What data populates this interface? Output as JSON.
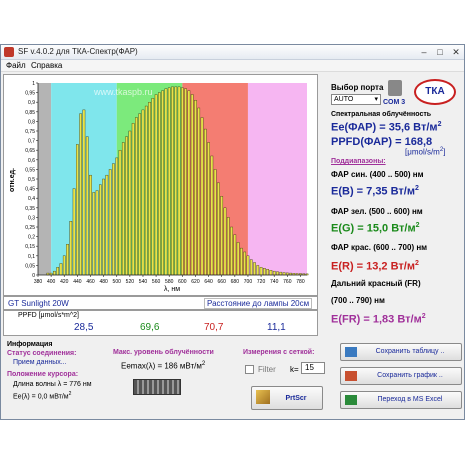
{
  "window": {
    "title": "SF v.4.0.2 для ТКА-Спектр(ФАР)",
    "menu": [
      "Файл",
      "Справка"
    ]
  },
  "plot": {
    "ylabel": "отн.ед.",
    "xlabel": "λ, нм",
    "watermark": "www.tkaspb.ru",
    "y_ticks": [
      "1",
      "0,95",
      "0,9",
      "0,85",
      "0,8",
      "0,75",
      "0,7",
      "0,65",
      "0,6",
      "0,55",
      "0,5",
      "0,45",
      "0,4",
      "0,35",
      "0,3",
      "0,25",
      "0,2",
      "0,15",
      "0,1",
      "0,05",
      "0"
    ],
    "x_ticks": [
      "380",
      "400",
      "420",
      "440",
      "460",
      "480",
      "500",
      "520",
      "540",
      "560",
      "580",
      "600",
      "620",
      "640",
      "660",
      "680",
      "700",
      "720",
      "740",
      "760",
      "780"
    ],
    "bands": [
      {
        "from": 380,
        "to": 400,
        "color": "#b4b4b4"
      },
      {
        "from": 400,
        "to": 500,
        "color": "#7fe6ec"
      },
      {
        "from": 500,
        "to": 600,
        "color": "#7cea7c"
      },
      {
        "from": 600,
        "to": 700,
        "color": "#f47d72"
      },
      {
        "from": 700,
        "to": 790,
        "color": "#f6b6f2"
      }
    ],
    "bar_color": "#e8e44a"
  },
  "chart_data": {
    "type": "bar",
    "x": [
      380,
      385,
      390,
      395,
      400,
      405,
      410,
      415,
      420,
      425,
      430,
      435,
      440,
      445,
      450,
      455,
      460,
      465,
      470,
      475,
      480,
      485,
      490,
      495,
      500,
      505,
      510,
      515,
      520,
      525,
      530,
      535,
      540,
      545,
      550,
      555,
      560,
      565,
      570,
      575,
      580,
      585,
      590,
      595,
      600,
      605,
      610,
      615,
      620,
      625,
      630,
      635,
      640,
      645,
      650,
      655,
      660,
      665,
      670,
      675,
      680,
      685,
      690,
      695,
      700,
      705,
      710,
      715,
      720,
      725,
      730,
      735,
      740,
      745,
      750,
      755,
      760,
      765,
      770,
      775,
      780,
      785,
      790
    ],
    "values": [
      0,
      0,
      0,
      0.01,
      0.01,
      0.02,
      0.04,
      0.06,
      0.1,
      0.16,
      0.28,
      0.45,
      0.68,
      0.84,
      0.86,
      0.72,
      0.52,
      0.43,
      0.44,
      0.47,
      0.5,
      0.52,
      0.55,
      0.58,
      0.61,
      0.65,
      0.69,
      0.72,
      0.75,
      0.79,
      0.82,
      0.84,
      0.86,
      0.88,
      0.9,
      0.92,
      0.94,
      0.95,
      0.96,
      0.97,
      0.975,
      0.98,
      0.98,
      0.98,
      0.975,
      0.97,
      0.96,
      0.94,
      0.91,
      0.87,
      0.82,
      0.76,
      0.69,
      0.62,
      0.55,
      0.48,
      0.41,
      0.35,
      0.3,
      0.25,
      0.21,
      0.17,
      0.14,
      0.12,
      0.1,
      0.08,
      0.065,
      0.05,
      0.04,
      0.035,
      0.03,
      0.025,
      0.02,
      0.017,
      0.015,
      0.013,
      0.011,
      0.01,
      0.009,
      0.008,
      0.008,
      0.007,
      0.006
    ],
    "xlabel": "λ, нм",
    "ylabel": "отн.ед.",
    "xlim": [
      380,
      790
    ],
    "ylim": [
      0,
      1
    ],
    "grid": false
  },
  "info": {
    "lamp": "GT Sunlight 20W",
    "distance": "Расстояние до лампы 20см"
  },
  "ppfd": {
    "label": "PPFD [μmol/s*m^2]",
    "values": [
      {
        "value": "28,5",
        "color": "#1a2a9a"
      },
      {
        "value": "69,6",
        "color": "#1a8a1a"
      },
      {
        "value": "70,7",
        "color": "#c82020"
      },
      {
        "value": "11,1",
        "color": "#1a2a9a"
      }
    ]
  },
  "port": {
    "label": "Выбор порта",
    "value": "AUTO",
    "com": "COM 3",
    "logo": "ТКА"
  },
  "results": {
    "section_title": "Спектральная облучённость",
    "ee_far": "Ee(ФАР) = 35,6 Вт/м",
    "ee_far_sup": "2",
    "ppfd_far": "PPFD(ФАР) = 168,8",
    "ppfd_unit": "[μmol/s/m",
    "ppfd_unit_sup": "2",
    "ppfd_unit_end": "]",
    "subranges_title": "Поддиапазоны:",
    "blue_label": "ФАР син. (400 .. 500) нм",
    "blue_value": "E(B) = 7,35 Вт/м",
    "green_label": "ФАР зел. (500 .. 600) нм",
    "green_value": "E(G) = 15,0 Вт/м",
    "red_label": "ФАР крас. (600 .. 700) нм",
    "red_value": "E(R) = 13,2 Вт/м",
    "fr_label": "Дальний красный (FR)",
    "fr_range": "(700 .. 790) нм",
    "fr_value": "E(FR) = 1,83 Вт/м",
    "sup2": "2"
  },
  "bottom": {
    "info_title": "Информация",
    "conn_label": "Статус соединения:",
    "conn_value": "Прием данных...",
    "cursor_label": "Положение курсора:",
    "wl_text": "Длина волны λ = 776 нм",
    "ee_text": "Ee(λ) = 0,0 мВт/м",
    "ee_sup": "2",
    "max_label": "Макс. уровень облучённости",
    "emax": "Eemax(λ) = 186 мВт/м",
    "emax_sup": "2",
    "series_label": "Измерения с сеткой:",
    "filter_label": "Filter",
    "k_label": "k=",
    "k_value": "15",
    "prtscr": "PrtScr",
    "btn_save_table": "Сохранить таблицу ..",
    "btn_save_graph": "Сохранить график ..",
    "btn_excel": "Переход в MS Excel"
  }
}
